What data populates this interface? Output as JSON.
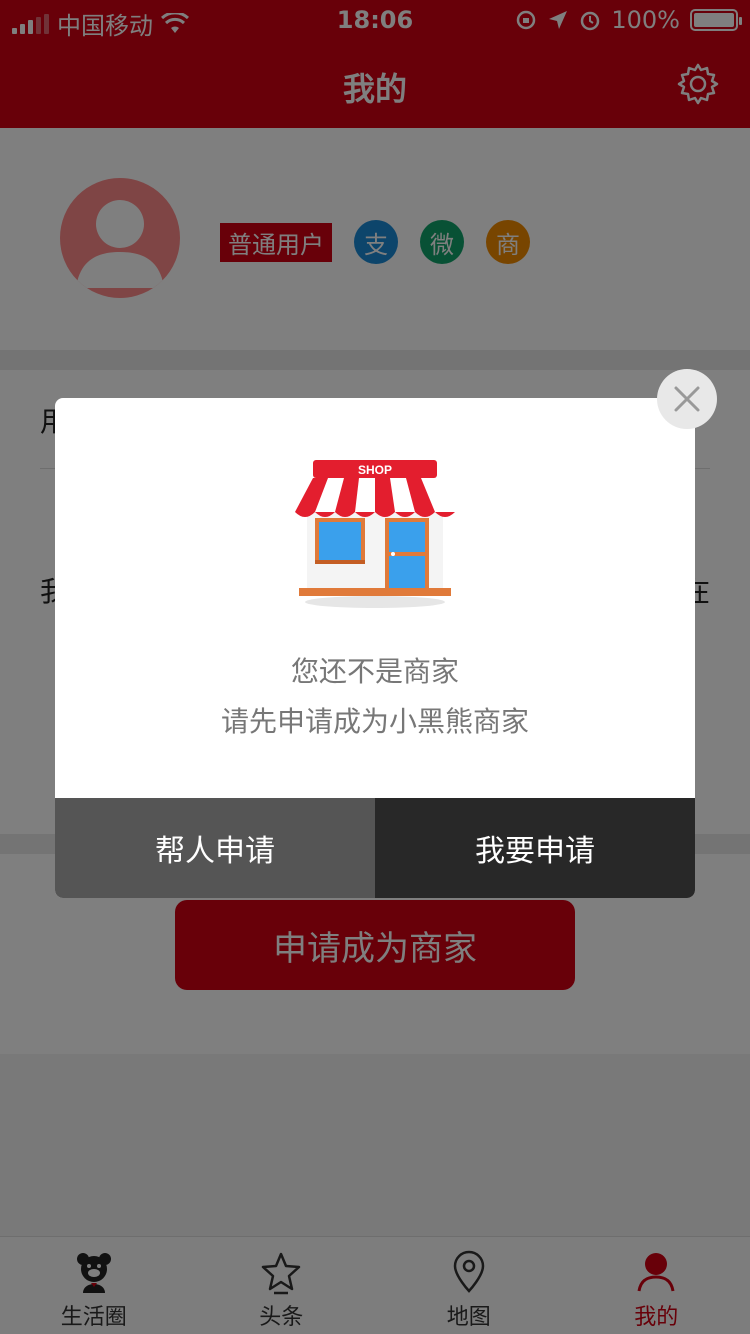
{
  "status_bar": {
    "carrier": "中国移动",
    "time": "18:06",
    "battery_text": "100%",
    "icons": [
      "signal-icon",
      "wifi-icon",
      "lock-rotation-icon",
      "location-arrow-icon",
      "alarm-icon",
      "battery-icon"
    ]
  },
  "header": {
    "title": "我的",
    "settings_icon": "gear-icon",
    "color": "#d10012"
  },
  "profile": {
    "user_type": "普通用户",
    "badges": [
      {
        "label": "支",
        "color": "#1b8ad6"
      },
      {
        "label": "微",
        "color": "#11a36b"
      },
      {
        "label": "商",
        "color": "#f08a00"
      }
    ]
  },
  "panel": {
    "row1_partial": "用",
    "row2_left_partial": "我",
    "row2_right_partial": "在"
  },
  "apply_button": {
    "label": "申请成为商家"
  },
  "modal": {
    "illustration": "shop-icon",
    "shop_sign": "SHOP",
    "message_line1": "您还不是商家",
    "message_line2": "请先申请成为小黑熊商家",
    "buttons": {
      "help_apply": "帮人申请",
      "self_apply": "我要申请"
    },
    "close_icon": "close-icon"
  },
  "tabbar": {
    "items": [
      {
        "label": "生活圈",
        "icon": "bear-icon",
        "active": false
      },
      {
        "label": "头条",
        "icon": "star-icon",
        "active": false
      },
      {
        "label": "地图",
        "icon": "map-pin-icon",
        "active": false
      },
      {
        "label": "我的",
        "icon": "person-icon",
        "active": true
      }
    ],
    "active_color": "#d10012"
  }
}
